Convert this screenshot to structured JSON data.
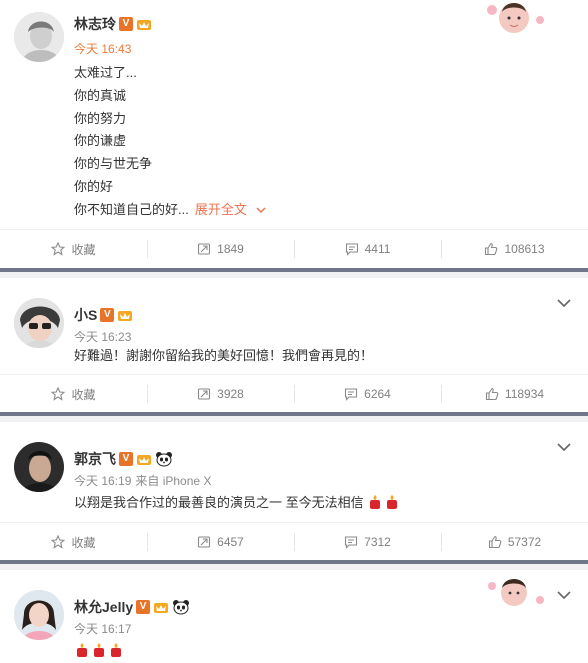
{
  "posts": [
    {
      "name": "林志玲",
      "time": "今天 16:43",
      "source": "",
      "lines": [
        "太难过了...",
        "你的真诚",
        "你的努力",
        "你的谦虚",
        "你的与世无争",
        "你的好",
        "你不知道自己的好..."
      ],
      "expand_label": "展开全文",
      "actions": {
        "favorite": "收藏",
        "repost": "1849",
        "comment": "4411",
        "like": "108613"
      }
    },
    {
      "name": "小S",
      "time": "今天 16:23",
      "source": "",
      "lines": [
        "好難過！謝謝你留給我的美好回憶！我們會再見的！"
      ],
      "actions": {
        "favorite": "收藏",
        "repost": "3928",
        "comment": "6264",
        "like": "118934"
      }
    },
    {
      "name": "郭京飞",
      "time": "今天 16:19",
      "source": "来自 iPhone X",
      "lines": [
        "以翔是我合作过的最善良的演员之一  至今无法相信"
      ],
      "actions": {
        "favorite": "收藏",
        "repost": "6457",
        "comment": "7312",
        "like": "57372"
      }
    },
    {
      "name": "林允Jelly",
      "time": "今天 16:17",
      "source": "",
      "lines": [
        ""
      ]
    }
  ],
  "colors": {
    "orange": "#f0793a",
    "link": "#eb7350",
    "divider_bar": "#6f7788"
  },
  "icons": [
    "star-icon",
    "repost-icon",
    "comment-icon",
    "thumb-up-icon",
    "chevron-down-icon",
    "candle-emoji",
    "panda-icon"
  ]
}
